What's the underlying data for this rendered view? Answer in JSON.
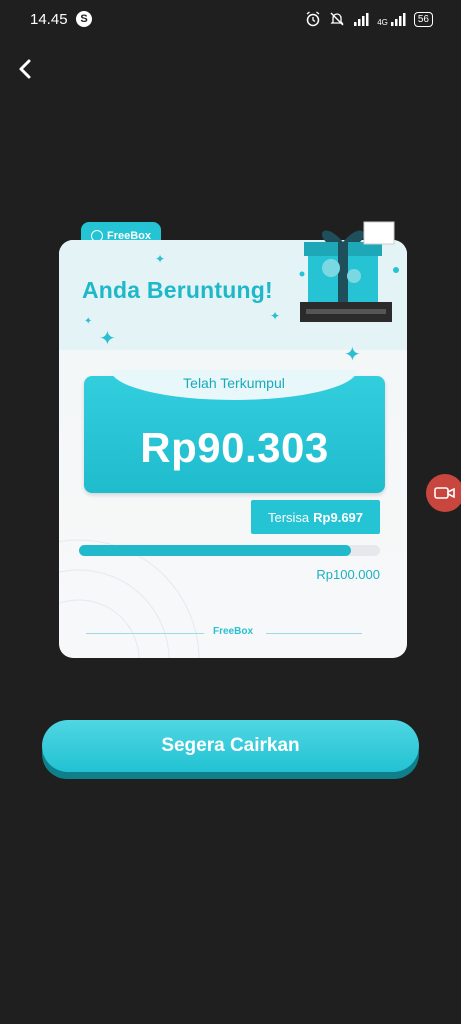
{
  "status_bar": {
    "time": "14.45",
    "notification_badge": "S",
    "battery": "56",
    "network": "4G",
    "icons": [
      "alarm-icon",
      "mute-icon",
      "signal-icon",
      "signal-4g-icon",
      "battery-icon"
    ]
  },
  "header": {
    "back_icon": "chevron-left-icon"
  },
  "card": {
    "brand": "FreeBox",
    "headline": "Anda Beruntung!",
    "collected_label": "Telah Terkumpul",
    "collected_amount": "Rp90.303",
    "remaining_label": "Tersisa",
    "remaining_amount": "Rp9.697",
    "progress_fraction": 0.903,
    "target_amount": "Rp100.000",
    "footer_brand": "FreeBox"
  },
  "cta": {
    "label": "Segera Cairkan"
  },
  "colors": {
    "accent": "#22c2d2",
    "background": "#1f1f1f",
    "record": "#c9463e"
  }
}
